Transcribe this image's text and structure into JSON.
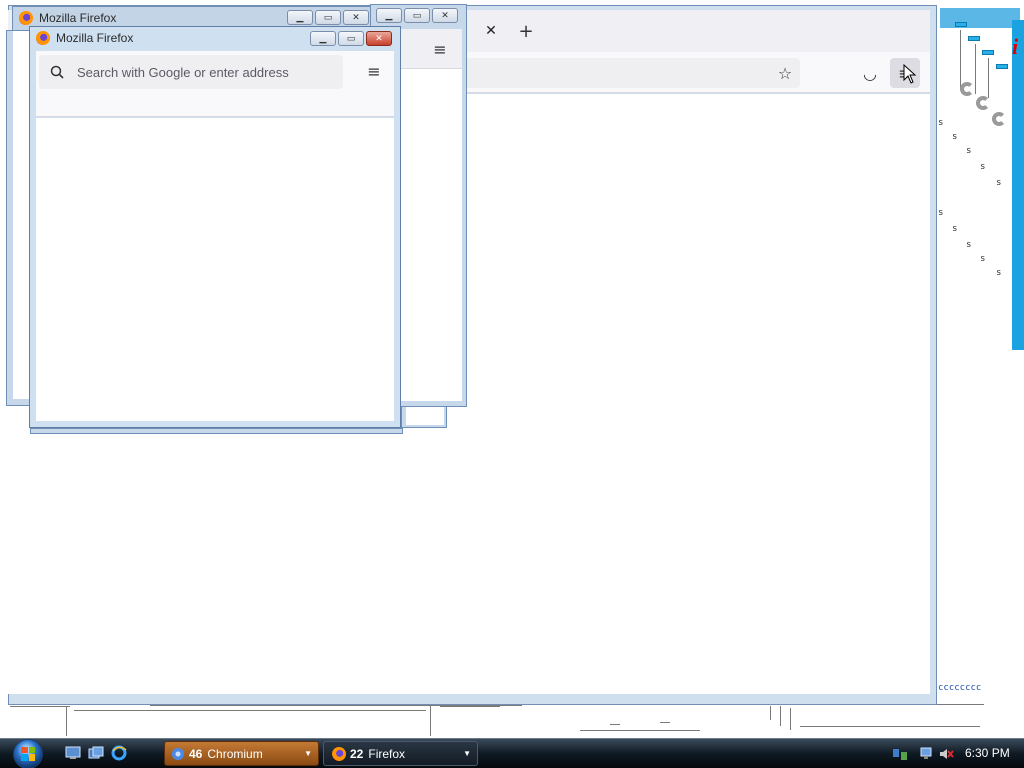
{
  "windows": {
    "main": {
      "toolbar": {
        "tab_close": "✕",
        "new_tab": "+",
        "star": "☆",
        "pocket": "◡",
        "menu": "≡"
      }
    },
    "middle": {
      "title": "Mozilla Firefox",
      "menu": "≡"
    },
    "small": {
      "title": "Mozilla Firefox",
      "search_placeholder": "Search with Google or enter address",
      "menu": "≡"
    }
  },
  "taskbar": {
    "chromium": {
      "count": "46",
      "label": "Chromium"
    },
    "firefox": {
      "count": "22",
      "label": "Firefox"
    },
    "clock": "6:30 PM"
  },
  "desktop": {
    "residue_text": "cccccccc"
  },
  "colors": {
    "accent": "#1aa3e0",
    "titlebar": "#cfe0f0",
    "chromium_button": "#c47a35"
  }
}
